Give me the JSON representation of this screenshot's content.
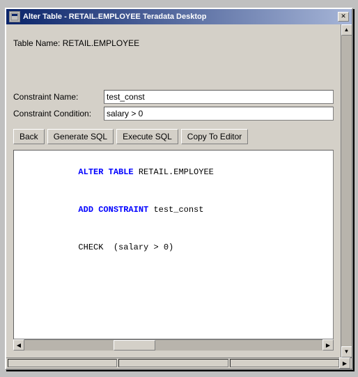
{
  "window": {
    "title": "Alter Table - RETAIL.EMPLOYEE Teradata Desktop",
    "close_label": "✕"
  },
  "content": {
    "table_name_label": "Table Name: RETAIL.EMPLOYEE",
    "constraint_name_label": "Constraint Name:",
    "constraint_name_value": "test_const",
    "constraint_condition_label": "Constraint Condition:",
    "constraint_condition_value": "salary > 0",
    "buttons": {
      "back": "Back",
      "generate_sql": "Generate SQL",
      "execute_sql": "Execute SQL",
      "copy_to_editor": "Copy To Editor"
    },
    "sql_lines": [
      {
        "type": "mixed",
        "parts": [
          {
            "text": "ALTER TABLE",
            "style": "keyword"
          },
          {
            "text": " RETAIL.EMPLOYEE",
            "style": "plain"
          }
        ]
      },
      {
        "type": "mixed",
        "parts": [
          {
            "text": "ADD CONSTRAINT",
            "style": "keyword"
          },
          {
            "text": " test_const",
            "style": "plain"
          }
        ]
      },
      {
        "type": "mixed",
        "parts": [
          {
            "text": "CHECK  (salary > 0)",
            "style": "plain"
          }
        ]
      }
    ]
  }
}
